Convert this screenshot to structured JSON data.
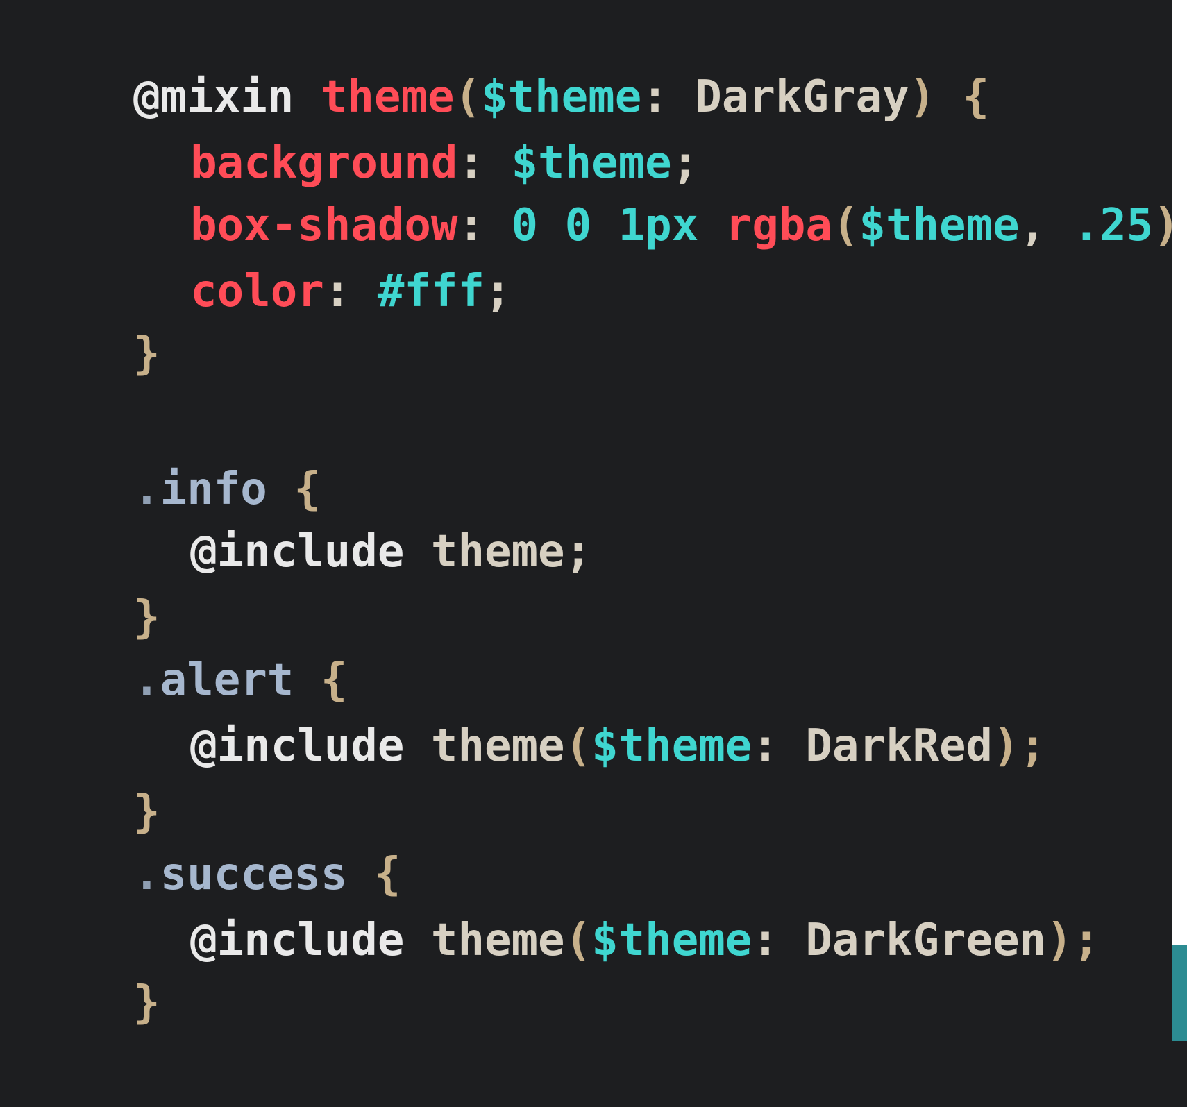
{
  "code": {
    "lines": [
      {
        "tokens": [
          "@mixin",
          " ",
          "theme",
          "(",
          "$theme",
          ": ",
          "DarkGray",
          ") ",
          "{"
        ]
      },
      {
        "tokens": [
          "background",
          ": ",
          "$theme",
          ";"
        ]
      },
      {
        "tokens": [
          "box-shadow",
          ": ",
          "0 0 1px ",
          "rgba",
          "(",
          "$theme",
          ", ",
          ".25",
          ");"
        ]
      },
      {
        "tokens": [
          "color",
          ": ",
          "#fff",
          ";"
        ]
      },
      {
        "tokens": [
          "}"
        ]
      },
      {
        "tokens": []
      },
      {
        "tokens": [
          ".",
          "info",
          " {"
        ]
      },
      {
        "tokens": [
          "@include",
          " ",
          "theme",
          ";"
        ]
      },
      {
        "tokens": [
          "}"
        ]
      },
      {
        "tokens": [
          ".",
          "alert",
          " {"
        ]
      },
      {
        "tokens": [
          "@include",
          " ",
          "theme",
          "(",
          "$theme",
          ": ",
          "DarkRed",
          ");"
        ]
      },
      {
        "tokens": [
          "}"
        ]
      },
      {
        "tokens": [
          ".",
          "success",
          " {"
        ]
      },
      {
        "tokens": [
          "@include",
          " ",
          "theme",
          "(",
          "$theme",
          ": ",
          "DarkGreen",
          ");"
        ]
      },
      {
        "tokens": [
          "}"
        ]
      }
    ]
  },
  "colors": {
    "background": "#1d1e20",
    "keyword": "#e9e9e9",
    "property": "#ff4c57",
    "variable": "#3fd6d0",
    "punctuation": "#c7b08a",
    "plain": "#d7d0c2",
    "selector": "#a6b7ce",
    "scrollbar_thumb": "#2c8c92"
  }
}
